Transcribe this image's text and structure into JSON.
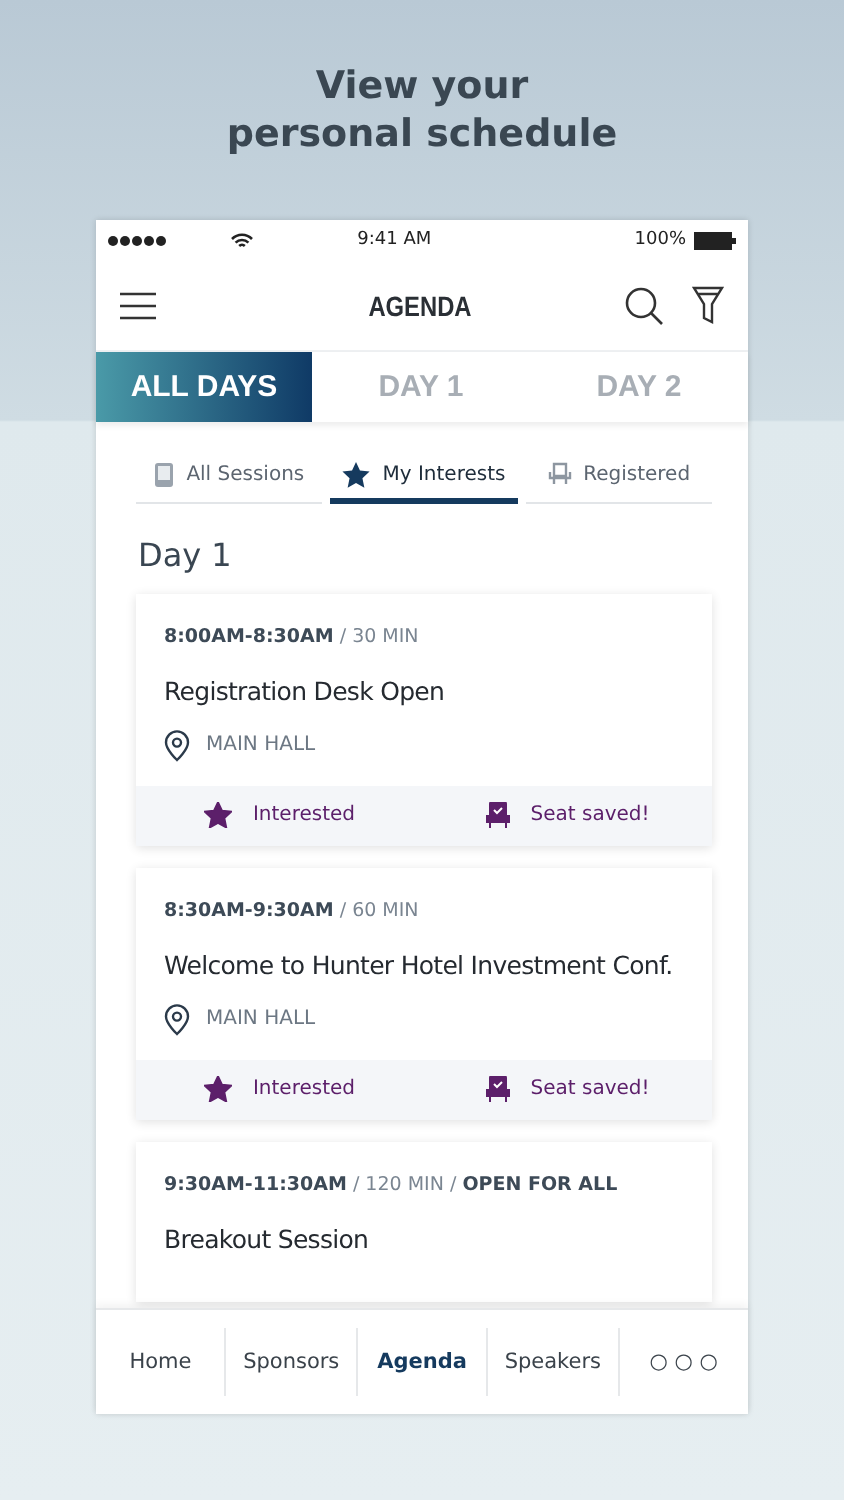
{
  "headline": "View your personal schedule",
  "status_bar": {
    "time": "9:41 AM",
    "battery": "100%"
  },
  "header": {
    "title": "AGENDA"
  },
  "day_tabs": [
    {
      "label": "ALL DAYS",
      "selected": true
    },
    {
      "label": "DAY 1",
      "selected": false
    },
    {
      "label": "DAY 2",
      "selected": false
    }
  ],
  "filter_tabs": [
    {
      "label": "All Sessions",
      "kind": "sessions",
      "selected": false
    },
    {
      "label": "My Interests",
      "kind": "interests",
      "selected": true
    },
    {
      "label": "Registered",
      "kind": "registered",
      "selected": false
    }
  ],
  "day_heading": "Day 1",
  "sessions": [
    {
      "time": "**8:00AM-8:30AM** / 30 MIN",
      "title": "Registration Desk Open",
      "location": "MAIN HALL",
      "interested": true,
      "interested_label": "Interested",
      "seat_saved": true,
      "seat_label": "Seat saved!"
    },
    {
      "time": "**8:30AM-9:30AM** / 60 MIN",
      "title": "Welcome to Hunter Hotel Investment Conf.",
      "location": "MAIN HALL",
      "interested": true,
      "interested_label": "Interested",
      "seat_saved": true,
      "seat_label": "Seat saved!"
    },
    {
      "time": "**9:30AM-11:30AM** / 120 MIN / **OPEN FOR ALL**",
      "title": "Breakout Session"
    }
  ],
  "bottom_tabs": [
    {
      "label": "Home",
      "selected": false
    },
    {
      "label": "Sponsors",
      "selected": false
    },
    {
      "label": "Agenda",
      "selected": true
    },
    {
      "label": "Speakers",
      "selected": false
    },
    {
      "label": "○ ○ ○",
      "selected": false
    }
  ]
}
